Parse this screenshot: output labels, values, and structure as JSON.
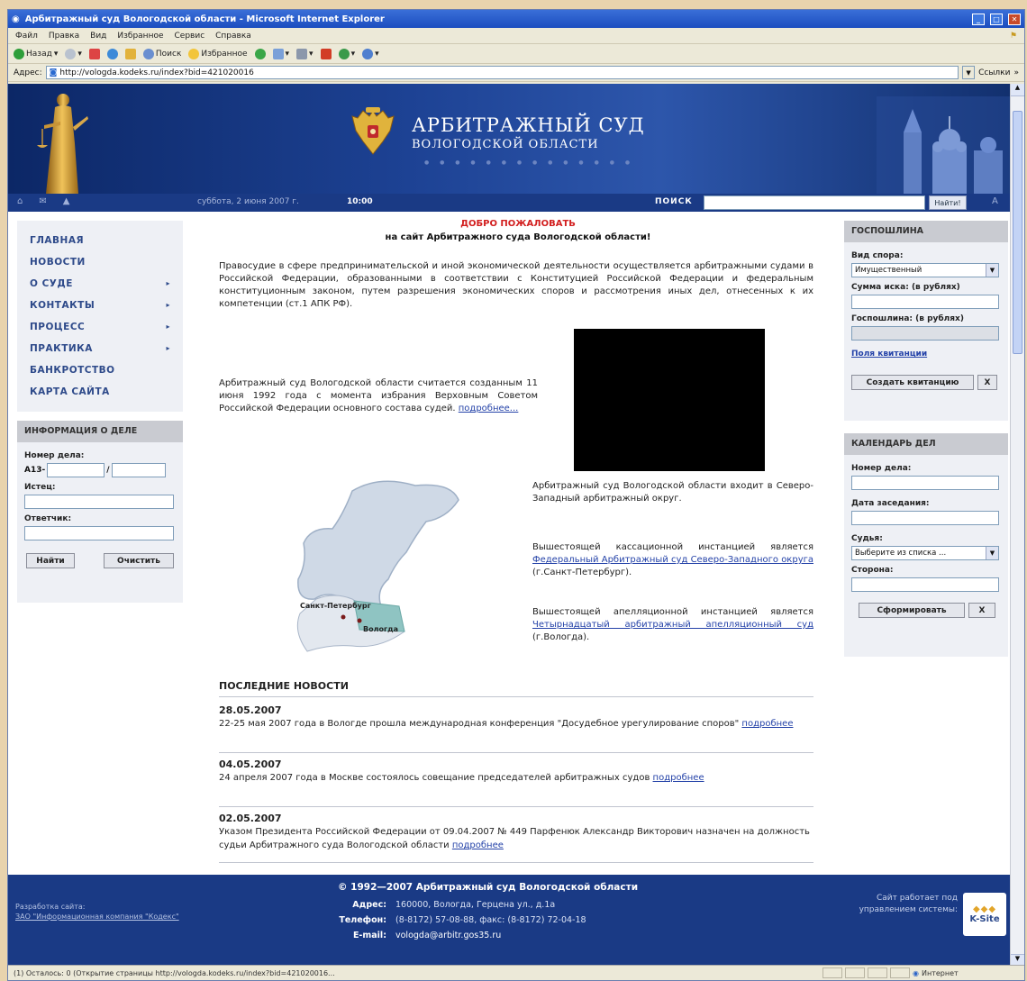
{
  "browser": {
    "title": "Арбитражный суд Вологодской области - Microsoft Internet Explorer",
    "menu": [
      "Файл",
      "Правка",
      "Вид",
      "Избранное",
      "Сервис",
      "Справка"
    ],
    "toolbar": {
      "back": "Назад",
      "search": "Поиск",
      "favorites": "Избранное"
    },
    "address_label": "Адрес:",
    "address": "http://vologda.kodeks.ru/index?bid=421020016",
    "links_label": "Ссылки",
    "status_text": "(1) Осталось: 0 (Открытие страницы http://vologda.kodeks.ru/index?bid=421020016...",
    "zone_text": "Интернет"
  },
  "site": {
    "title_line1": "АРБИТРАЖНЫЙ СУД",
    "title_line2": "ВОЛОГОДСКОЙ ОБЛАСТИ",
    "date": "суббота, 2 июня 2007 г.",
    "time": "10:00",
    "search_label": "ПОИСК",
    "search_button": "Найти!",
    "menu": [
      {
        "label": "ГЛАВНАЯ",
        "arrow": ""
      },
      {
        "label": "НОВОСТИ",
        "arrow": ""
      },
      {
        "label": "О СУДЕ",
        "arrow": "▸"
      },
      {
        "label": "КОНТАКТЫ",
        "arrow": "▸"
      },
      {
        "label": "ПРОЦЕСС",
        "arrow": "▸"
      },
      {
        "label": "ПРАКТИКА",
        "arrow": "▸"
      },
      {
        "label": "БАНКРОТСТВО",
        "arrow": ""
      },
      {
        "label": "КАРТА САЙТА",
        "arrow": ""
      }
    ],
    "case_info": {
      "title": "ИНФОРМАЦИЯ О ДЕЛЕ",
      "case_number_label": "Номер дела:",
      "prefix": "А13-",
      "slash": "/",
      "plaintiff_label": "Истец:",
      "defendant_label": "Ответчик:",
      "find_button": "Найти",
      "clear_button": "Очистить"
    },
    "welcome_title": "ДОБРО ПОЖАЛОВАТЬ",
    "welcome_subtitle": "на сайт Арбитражного суда Вологодской области!",
    "intro": "Правосудие в сфере предпринимательской и иной экономической деятельности осуществляется арбитражными судами в Российской Федерации, образованными в соответствии с Конституцией Российской Федерации и федеральным конституционным законом, путем разрешения экономических споров и рассмотрения иных дел, отнесенных к их компетенции (ст.1 АПК РФ).",
    "founded_text": "Арбитражный суд Вологодской области считается созданным 11 июня 1992 года с момента избрания Верховным Советом Российской Федерации основного состава судей.",
    "founded_link": "подробнее...",
    "map_labels": {
      "spb": "Санкт-Петербург",
      "vologda": "Вологда"
    },
    "district_text": "Арбитражный суд Вологодской области входит в Северо-Западный арбитражный округ.",
    "cassation_text": "Вышестоящей кассационной инстанцией является",
    "cassation_link": "Федеральный Арбитражный суд Северо-Западного округа",
    "cassation_tail": "(г.Санкт-Петербург).",
    "appeal_text": "Вышестоящей апелляционной инстанцией является",
    "appeal_link": "Четырнадцатый арбитражный апелляционный суд",
    "appeal_tail": "(г.Вологда).",
    "news_title": "ПОСЛЕДНИЕ НОВОСТИ",
    "news": [
      {
        "date": "28.05.2007",
        "text": "22-25 мая 2007 года в Вологде прошла международная конференция \"Досудебное урегулирование споров\"",
        "link": "подробнее"
      },
      {
        "date": "04.05.2007",
        "text": "24 апреля 2007 года в Москве состоялось совещание председателей арбитражных судов",
        "link": "подробнее"
      },
      {
        "date": "02.05.2007",
        "text": "Указом Президента Российской Федерации от 09.04.2007 № 449 Парфенюк Александр Викторович назначен на должность судьи Арбитражного суда Вологодской области",
        "link": "подробнее"
      }
    ],
    "gosposhlina": {
      "title": "ГОСПОШЛИНА",
      "dispute_label": "Вид спора:",
      "dispute_value": "Имущественный",
      "claim_label": "Сумма иска: (в рублях)",
      "duty_label": "Госпошлина: (в рублях)",
      "receipt_link": "Поля квитанции",
      "create_button": "Создать квитанцию",
      "x_button": "X"
    },
    "calendar": {
      "title": "КАЛЕНДАРЬ ДЕЛ",
      "case_label": "Номер дела:",
      "date_label": "Дата заседания:",
      "judge_label": "Судья:",
      "judge_value": "Выберите из списка ...",
      "party_label": "Сторона:",
      "form_button": "Сформировать",
      "x_button": "X"
    },
    "footer": {
      "dev_line1": "Разработка сайта:",
      "dev_line2": "ЗАО \"Информационная компания \"Кодекс\"",
      "copyright": "© 1992—2007 Арбитражный суд Вологодской области",
      "address_label": "Адрес:",
      "address": "160000, Вологда, Герцена ул., д.1а",
      "phone_label": "Телефон:",
      "phone": "(8-8172) 57-08-88, факс: (8-8172) 72-04-18",
      "email_label": "E-mail:",
      "email": "vologda@arbitr.gos35.ru",
      "site_runs": "Сайт работает под управлением системы:",
      "ksite": "K-Site"
    }
  }
}
